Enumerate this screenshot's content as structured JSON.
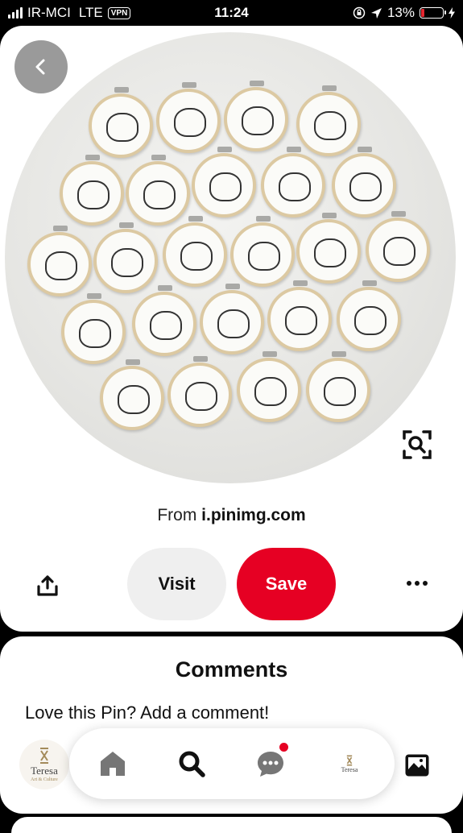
{
  "status_bar": {
    "carrier": "IR-MCI",
    "network": "LTE",
    "vpn": "VPN",
    "time": "11:24",
    "battery": "13%",
    "battery_level": 0.13,
    "battery_color": "#e5262f"
  },
  "pin": {
    "image_icon": "embroidery-hoops-photo",
    "source_prefix": "From",
    "source_domain": "i.pinimg.com",
    "visit_label": "Visit",
    "save_label": "Save",
    "save_color": "#e60023"
  },
  "comments": {
    "title": "Comments",
    "prompt": "Love this Pin? Add a comment!"
  },
  "bottom_nav": {
    "profile_logo": {
      "name": "Teresa",
      "tagline": "Art & Culture"
    },
    "items": [
      "home-icon",
      "search-icon",
      "messages-icon",
      "profile-icon"
    ],
    "notification_color": "#e60023"
  }
}
